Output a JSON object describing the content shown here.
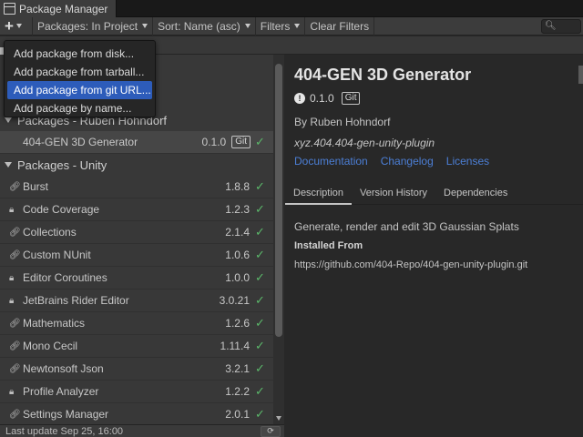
{
  "window": {
    "tab_title": "Package Manager"
  },
  "toolbar": {
    "packages_filter": "Packages: In Project",
    "sort": "Sort: Name (asc)",
    "filters": "Filters",
    "clear_filters": "Clear Filters"
  },
  "add_menu": {
    "items": [
      {
        "label": "Add package from disk..."
      },
      {
        "label": "Add package from tarball..."
      },
      {
        "label": "Add package from git URL..."
      },
      {
        "label": "Add package by name..."
      }
    ]
  },
  "list": {
    "group_hohndorf": "Packages - Ruben Hohndorf",
    "selected": {
      "name": "404-GEN 3D Generator",
      "version": "0.1.0",
      "badge": "Git"
    },
    "group_unity": "Packages - Unity",
    "packages": [
      {
        "name": "Burst",
        "version": "1.8.8",
        "icon": "link-icon"
      },
      {
        "name": "Code Coverage",
        "version": "1.2.3",
        "icon": "lock-icon"
      },
      {
        "name": "Collections",
        "version": "2.1.4",
        "icon": "link-icon"
      },
      {
        "name": "Custom NUnit",
        "version": "1.0.6",
        "icon": "link-icon"
      },
      {
        "name": "Editor Coroutines",
        "version": "1.0.0",
        "icon": "lock-icon"
      },
      {
        "name": "JetBrains Rider Editor",
        "version": "3.0.21",
        "icon": "lock-icon"
      },
      {
        "name": "Mathematics",
        "version": "1.2.6",
        "icon": "link-icon"
      },
      {
        "name": "Mono Cecil",
        "version": "1.11.4",
        "icon": "link-icon"
      },
      {
        "name": "Newtonsoft Json",
        "version": "3.2.1",
        "icon": "link-icon"
      },
      {
        "name": "Profile Analyzer",
        "version": "1.2.2",
        "icon": "lock-icon"
      },
      {
        "name": "Settings Manager",
        "version": "2.0.1",
        "icon": "link-icon"
      }
    ]
  },
  "status": {
    "last_update": "Last update Sep 25, 16:00"
  },
  "detail": {
    "title": "404-GEN 3D Generator",
    "version": "0.1.0",
    "badge": "Git",
    "author": "By Ruben Hohndorf",
    "package_id": "xyz.404.404-gen-unity-plugin",
    "links": {
      "documentation": "Documentation",
      "changelog": "Changelog",
      "licenses": "Licenses"
    },
    "tabs": {
      "description": "Description",
      "version_history": "Version History",
      "dependencies": "Dependencies"
    },
    "description": "Generate, render and edit 3D Gaussian Splats",
    "installed_from_label": "Installed From",
    "installed_from_value": "https://github.com/404-Repo/404-gen-unity-plugin.git"
  },
  "colors": {
    "accent": "#2d5cba",
    "check": "#5bb86a",
    "link": "#4c7fd6"
  }
}
